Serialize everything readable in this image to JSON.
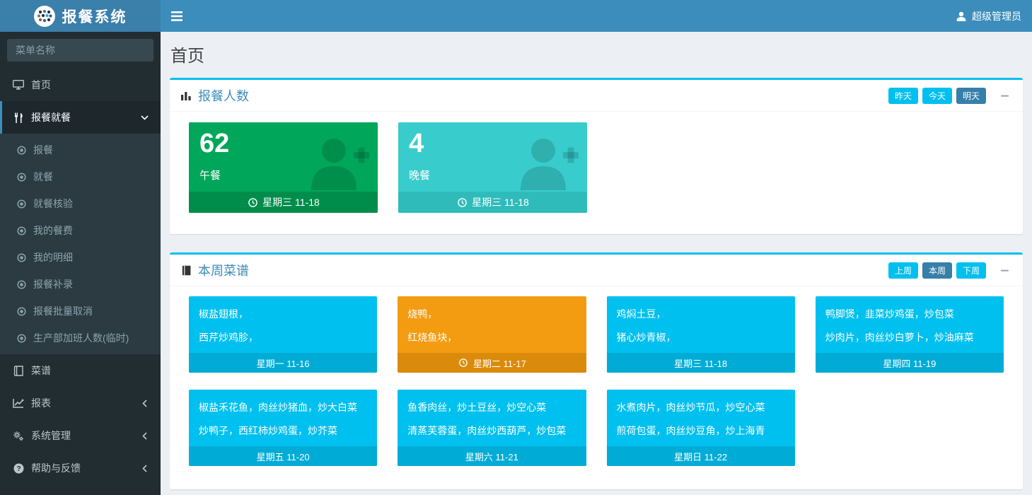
{
  "app": {
    "title": "报餐系统",
    "user": "超级管理员"
  },
  "sidebar": {
    "search_placeholder": "菜单名称",
    "home": "首页",
    "meal_parent": "报餐就餐",
    "meal_children": [
      "报餐",
      "就餐",
      "就餐核验",
      "我的餐费",
      "我的明细",
      "报餐补录",
      "报餐批量取消",
      "生产部加班人数(临时)"
    ],
    "recipes": "菜谱",
    "reports": "报表",
    "system": "系统管理",
    "help": "帮助与反馈"
  },
  "page": {
    "title": "首页"
  },
  "panels": {
    "meals": {
      "title": "报餐人数",
      "buttons": [
        "昨天",
        "今天",
        "明天"
      ],
      "cards": [
        {
          "value": "62",
          "label": "午餐",
          "date": "星期三 11-18"
        },
        {
          "value": "4",
          "label": "晚餐",
          "date": "星期三 11-18"
        }
      ]
    },
    "menu": {
      "title": "本周菜谱",
      "buttons": [
        "上周",
        "本周",
        "下周"
      ],
      "cards": [
        {
          "line1": "椒盐翅根，",
          "line2": "西芹炒鸡胗，",
          "date": "星期一 11-16"
        },
        {
          "line1": "烧鸭，",
          "line2": "红烧鱼块，",
          "date": "星期二 11-17"
        },
        {
          "line1": "鸡焖土豆，",
          "line2": "猪心炒青椒，",
          "date": "星期三 11-18"
        },
        {
          "line1": "鸭脚煲，韭菜炒鸡蛋，炒包菜",
          "line2": "炒肉片，肉丝炒白萝卜，炒油麻菜",
          "date": "星期四 11-19"
        },
        {
          "line1": "椒盐禾花鱼，肉丝炒猪血，炒大白菜",
          "line2": "炒鸭子，西红柿炒鸡蛋，炒芥菜",
          "date": "星期五 11-20"
        },
        {
          "line1": "鱼香肉丝，炒土豆丝，炒空心菜",
          "line2": "清蒸芙蓉蛋，肉丝炒西葫芦，炒包菜",
          "date": "星期六 11-21"
        },
        {
          "line1": "水煮肉片，肉丝炒节瓜，炒空心菜",
          "line2": "煎荷包蛋，肉丝炒豆角，炒上海青",
          "date": "星期日 11-22"
        }
      ]
    }
  },
  "colors": {
    "navbar": "#3c8dbc",
    "sidebar": "#222d32",
    "accent_aqua": "#00c0ef",
    "green": "#00a65a",
    "teal": "#39cccc",
    "orange": "#f39c12",
    "active_btn": "#367fa9"
  }
}
